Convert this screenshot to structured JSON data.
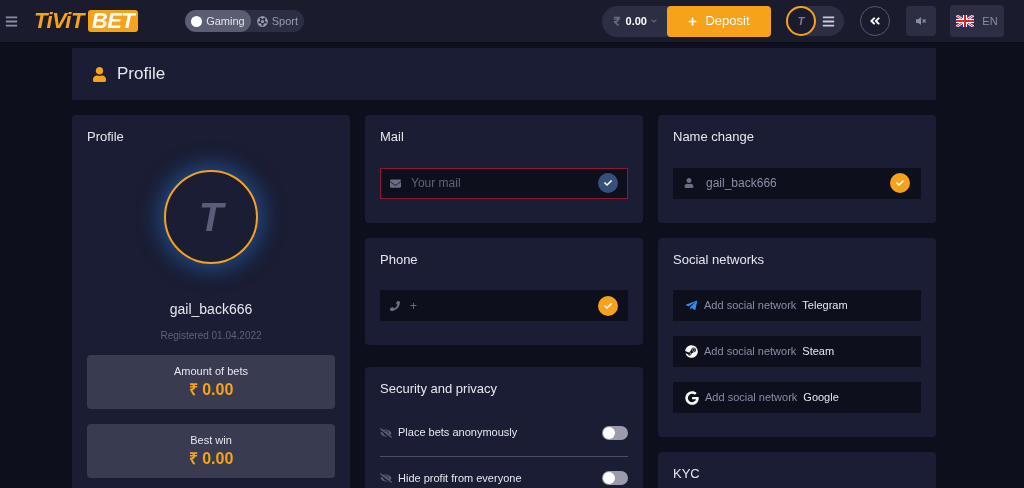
{
  "header": {
    "logo": {
      "first": "TiViT",
      "second": "BET"
    },
    "modes": [
      {
        "label": "Gaming",
        "selected": true
      },
      {
        "label": "Sport",
        "selected": false
      }
    ],
    "balance": "0.00",
    "deposit": "Deposit",
    "avatar_letter": "T",
    "language": "EN"
  },
  "page_title": "Profile",
  "profile": {
    "title": "Profile",
    "avatar_letter": "T",
    "username": "gail_back666",
    "registered": "Registered 01.04.2022",
    "stats": [
      {
        "label": "Amount of bets",
        "value": "₹ 0.00"
      },
      {
        "label": "Best win",
        "value": "₹ 0.00"
      }
    ]
  },
  "mail": {
    "title": "Mail",
    "placeholder": "Your mail",
    "invalid": true,
    "confirmed": false
  },
  "phone": {
    "title": "Phone",
    "value": "+",
    "invalid": false,
    "confirmed": true
  },
  "security": {
    "title": "Security and privacy",
    "options": [
      {
        "label": "Place bets anonymously",
        "on": false
      },
      {
        "label": "Hide profit from everyone",
        "on": false
      }
    ]
  },
  "name_change": {
    "title": "Name change",
    "value": "gail_back666",
    "confirmed": true
  },
  "social": {
    "title": "Social networks",
    "items": [
      {
        "kind": "telegram",
        "prefix": "Add social network",
        "name": "Telegram"
      },
      {
        "kind": "steam",
        "prefix": "Add social network",
        "name": "Steam"
      },
      {
        "kind": "google",
        "prefix": "Add social network",
        "name": "Google"
      }
    ]
  },
  "kyc": {
    "title": "KYC"
  }
}
